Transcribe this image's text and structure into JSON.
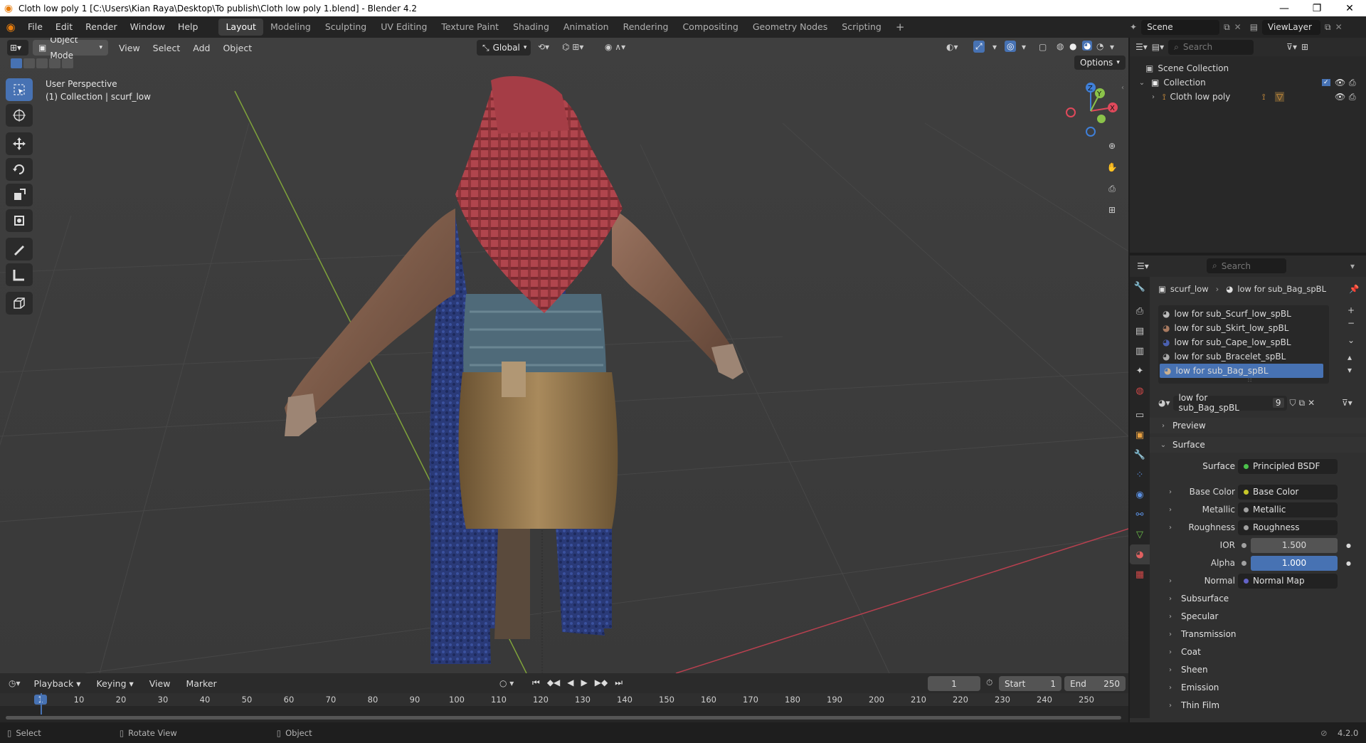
{
  "window": {
    "title": "Cloth low poly 1 [C:\\Users\\Kian Raya\\Desktop\\To publish\\Cloth low poly 1.blend] - Blender 4.2",
    "minimize": "—",
    "restore": "❐",
    "close": "✕"
  },
  "menu": {
    "file": "File",
    "edit": "Edit",
    "render": "Render",
    "window": "Window",
    "help": "Help"
  },
  "workspaces": [
    "Layout",
    "Modeling",
    "Sculpting",
    "UV Editing",
    "Texture Paint",
    "Shading",
    "Animation",
    "Rendering",
    "Compositing",
    "Geometry Nodes",
    "Scripting"
  ],
  "scene": {
    "label": "Scene",
    "viewlayer": "ViewLayer"
  },
  "viewport": {
    "mode": "Object Mode",
    "menus": [
      "View",
      "Select",
      "Add",
      "Object"
    ],
    "orientation": "Global",
    "options": "Options",
    "perspective": "User Perspective",
    "collection_info": "(1) Collection | scurf_low",
    "gizmo": {
      "x": "X",
      "y": "Y",
      "z": "Z"
    }
  },
  "outliner": {
    "search_placeholder": "Search",
    "scene_collection": "Scene Collection",
    "collection": "Collection",
    "object": "Cloth low poly"
  },
  "properties": {
    "search_placeholder": "Search",
    "breadcrumb_object": "scurf_low",
    "breadcrumb_material": "low for sub_Bag_spBL",
    "slots": [
      {
        "name": "low for sub_Scurf_low_spBL",
        "selected": false
      },
      {
        "name": "low for sub_Skirt_low_spBL",
        "selected": false
      },
      {
        "name": "low for sub_Cape_low_spBL",
        "selected": false
      },
      {
        "name": "low for sub_Bracelet_spBL",
        "selected": false
      },
      {
        "name": "low for sub_Bag_spBL",
        "selected": true
      }
    ],
    "material_name": "low for sub_Bag_spBL",
    "users": "9",
    "preview": "Preview",
    "surface_panel": "Surface",
    "surface_label": "Surface",
    "surface_value": "Principled BSDF",
    "inputs": [
      {
        "label": "Base Color",
        "value": "Base Color",
        "color": "#c7c729",
        "expand": true
      },
      {
        "label": "Metallic",
        "value": "Metallic",
        "color": "#a1a1a1",
        "expand": true
      },
      {
        "label": "Roughness",
        "value": "Roughness",
        "color": "#a1a1a1",
        "expand": true
      }
    ],
    "ior": {
      "label": "IOR",
      "value": "1.500"
    },
    "alpha": {
      "label": "Alpha",
      "value": "1.000"
    },
    "normal": {
      "label": "Normal",
      "value": "Normal Map",
      "color": "#6363c7"
    },
    "subpanels": [
      "Subsurface",
      "Specular",
      "Transmission",
      "Coat",
      "Sheen",
      "Emission",
      "Thin Film"
    ]
  },
  "timeline": {
    "menus": [
      "Playback",
      "Keying",
      "View",
      "Marker"
    ],
    "current_frame": "1",
    "start_label": "Start",
    "start": "1",
    "end_label": "End",
    "end": "250",
    "ticks": [
      "1",
      "10",
      "20",
      "30",
      "40",
      "50",
      "60",
      "70",
      "80",
      "90",
      "100",
      "110",
      "120",
      "130",
      "140",
      "150",
      "160",
      "170",
      "180",
      "190",
      "200",
      "210",
      "220",
      "230",
      "240",
      "250"
    ]
  },
  "status": {
    "select": "Select",
    "rotate": "Rotate View",
    "object": "Object",
    "version": "4.2.0"
  },
  "colors": {
    "accent": "#4772b3",
    "x_axis": "#e0495b",
    "y_axis": "#8bc34a",
    "z_axis": "#3f7fd8"
  }
}
